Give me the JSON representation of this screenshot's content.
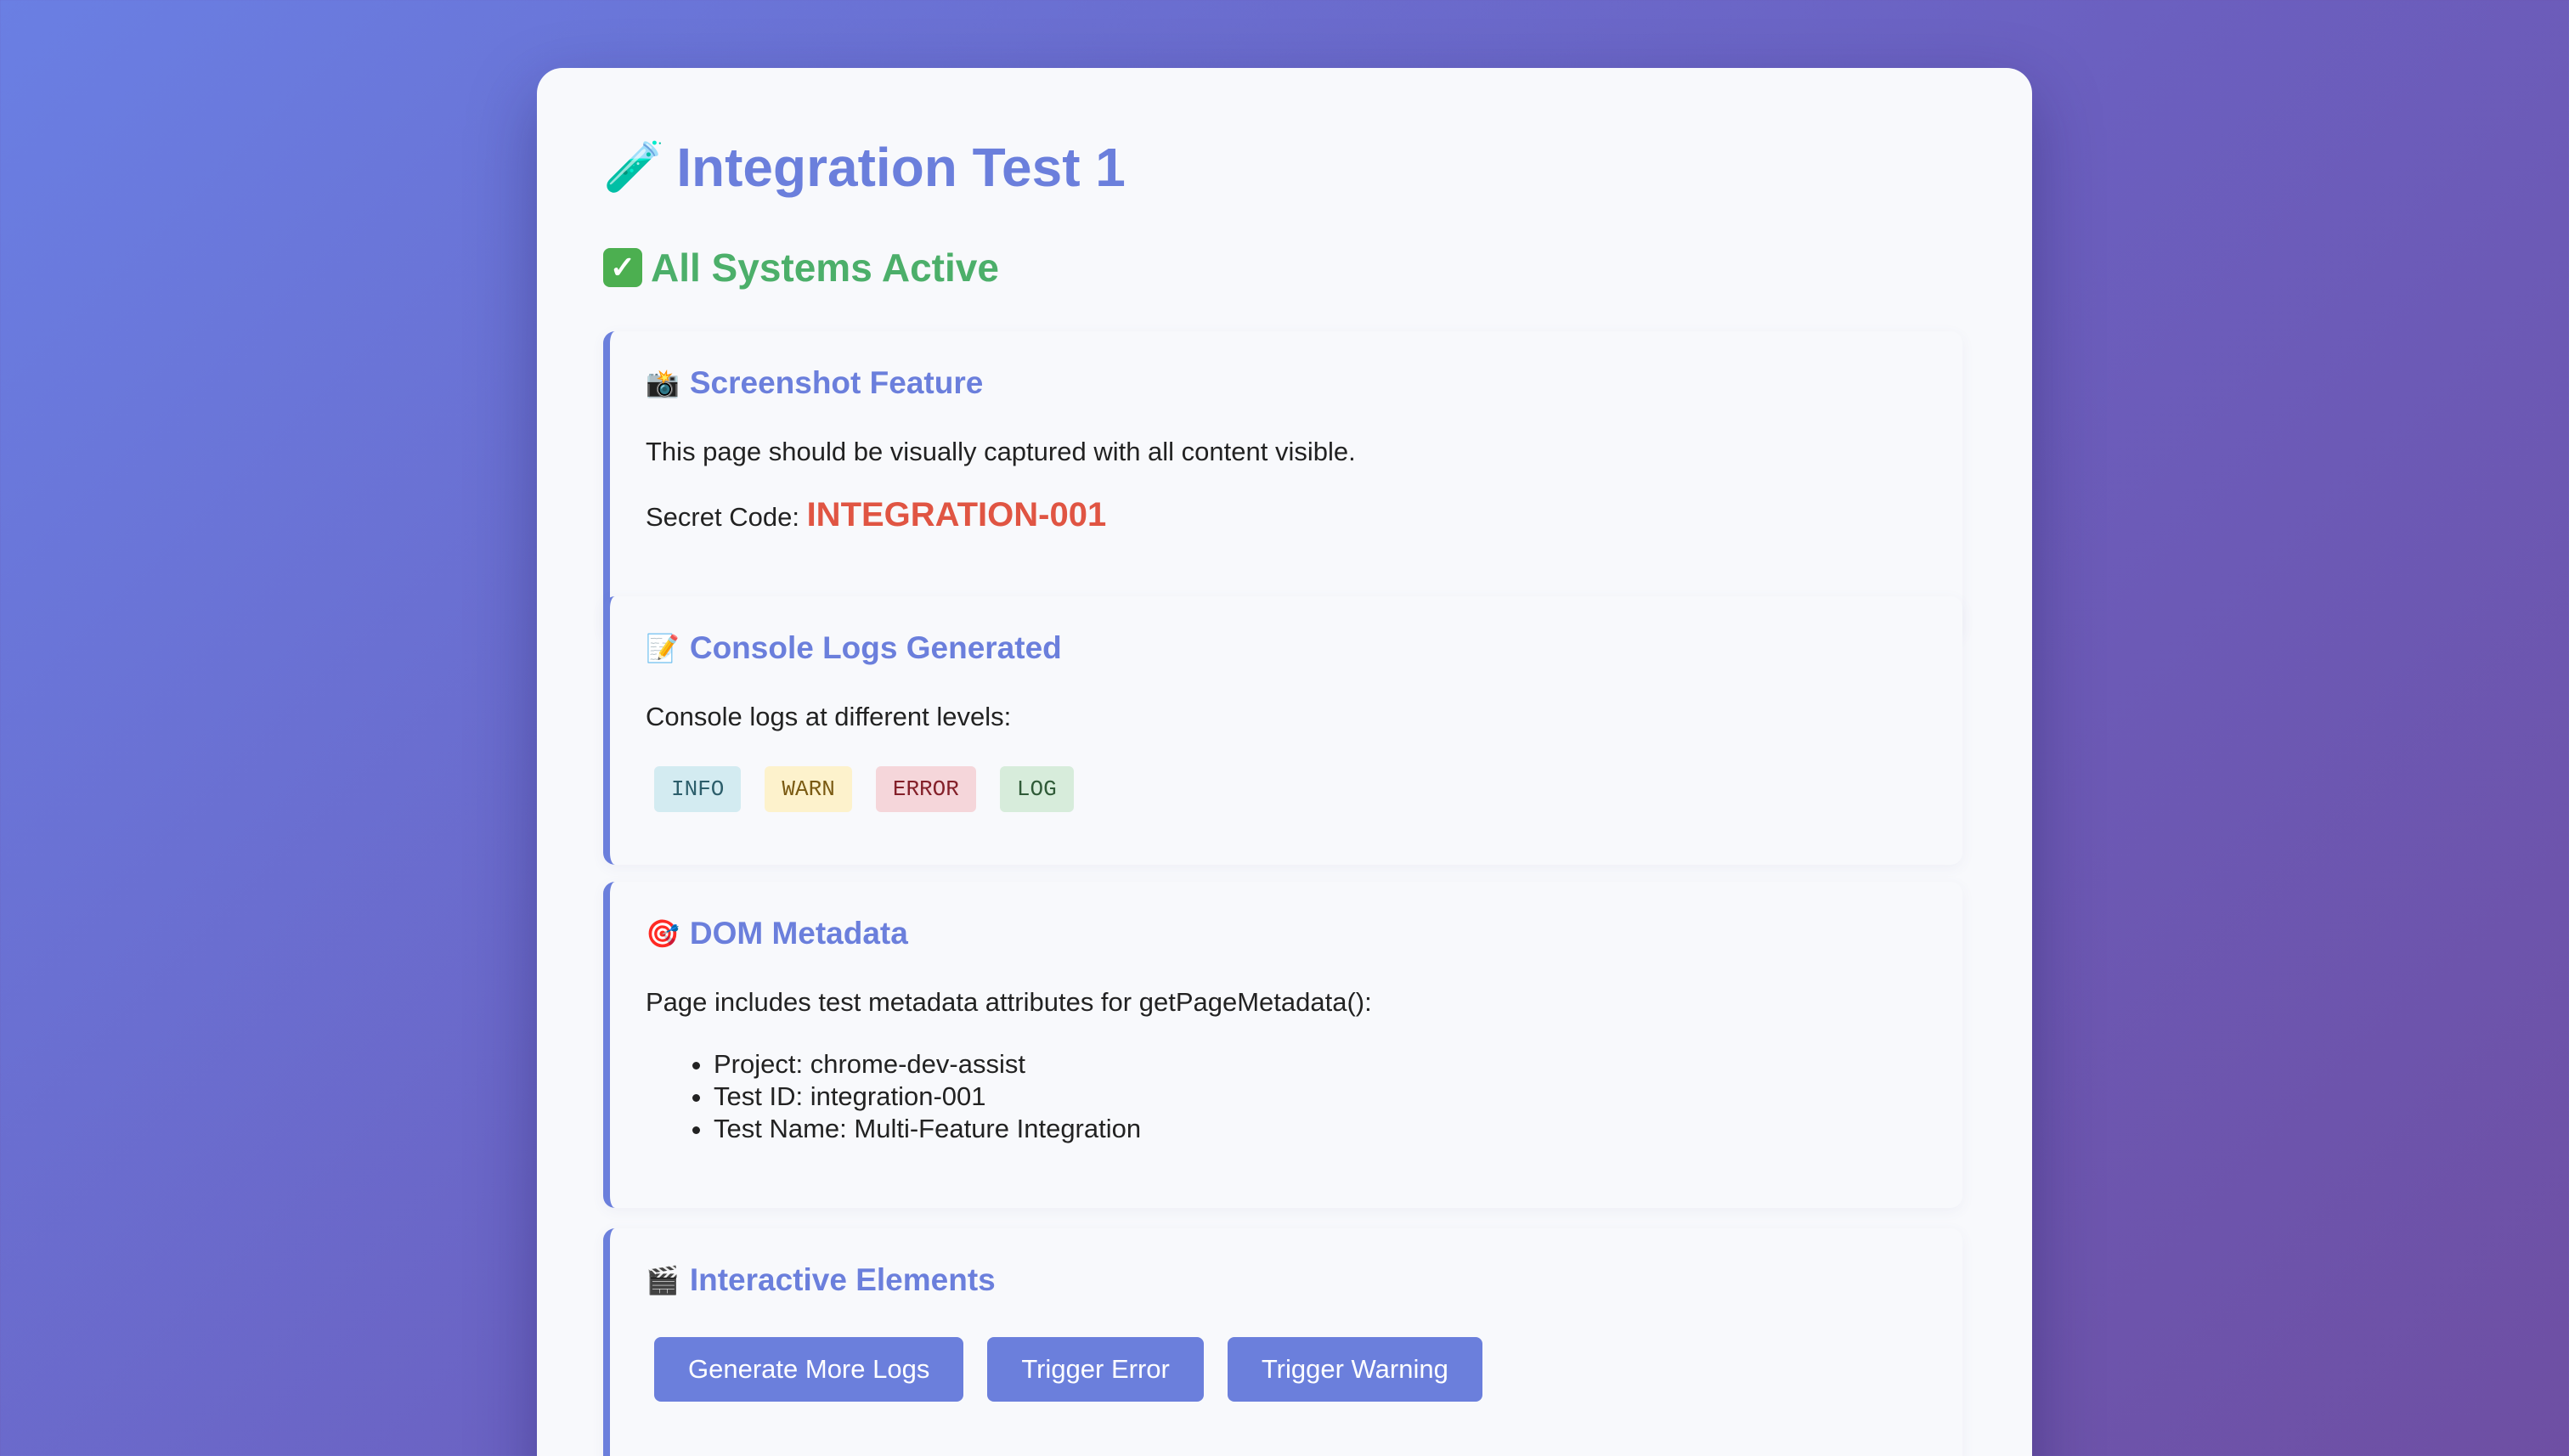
{
  "header": {
    "title_icon": "🧪",
    "title": "Integration Test 1",
    "status_icon": "✓",
    "status": "All Systems Active"
  },
  "screenshot_section": {
    "icon": "📸",
    "title": "Screenshot Feature",
    "description": "This page should be visually captured with all content visible.",
    "secret_label": "Secret Code:",
    "secret_value": "INTEGRATION-001"
  },
  "console_section": {
    "icon": "📝",
    "title": "Console Logs Generated",
    "description": "Console logs at different levels:",
    "levels": [
      "INFO",
      "WARN",
      "ERROR",
      "LOG"
    ]
  },
  "dom_section": {
    "icon": "🎯",
    "title": "DOM Metadata",
    "description": "Page includes test metadata attributes for getPageMetadata():",
    "items": [
      "Project: chrome-dev-assist",
      "Test ID: integration-001",
      "Test Name: Multi-Feature Integration"
    ]
  },
  "interactive_section": {
    "icon": "🎬",
    "title": "Interactive Elements",
    "buttons": [
      "Generate More Logs",
      "Trigger Error",
      "Trigger Warning"
    ]
  },
  "colors": {
    "accent": "#6b7fdc",
    "success": "#4caf6a",
    "code": "#e05543"
  }
}
